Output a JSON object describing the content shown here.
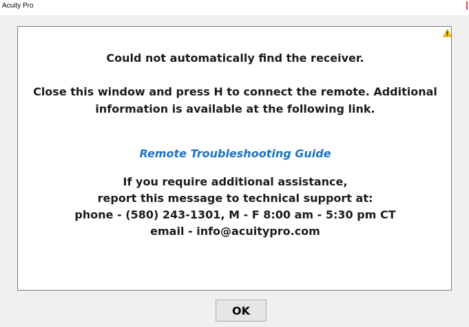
{
  "window": {
    "title": "Acuity Pro"
  },
  "dialog": {
    "heading": "Could not automatically find the receiver.",
    "instruction_line1": "Close this window and press H to connect the remote. Additional",
    "instruction_line2": "information is available at the following link.",
    "link_text": "Remote Troubleshooting Guide",
    "support_line1": "If you require additional assistance,",
    "support_line2": "report this message to technical support at:",
    "support_line3": "phone - (580) 243-1301, M - F 8:00 am - 5:30 pm CT",
    "support_line4": "email - info@acuitypro.com",
    "ok_label": "OK",
    "icon": "warning-icon"
  },
  "colors": {
    "text": "#1a1a1a",
    "link": "#1a73c4",
    "accent": "#d24726",
    "warning": "#f2c40f"
  }
}
